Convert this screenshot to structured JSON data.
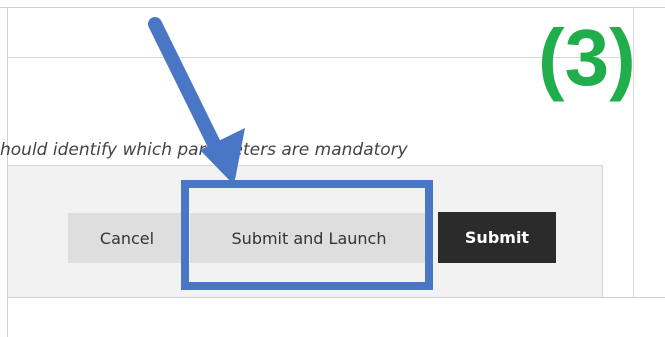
{
  "form": {
    "hint_text": "hould identify which parameters are mandatory"
  },
  "footer": {
    "cancel_label": "Cancel",
    "submit_launch_label": "Submit and Launch",
    "submit_label": "Submit"
  },
  "annotation": {
    "step_label": "(3)",
    "highlight_color": "#4a76c6",
    "step_color": "#1fae4b",
    "arrow_icon": "arrow-down-right-icon"
  },
  "colors": {
    "submit_bg": "#2b2b2b",
    "secondary_bg": "#dedede",
    "footer_bg": "#f2f2f2"
  }
}
